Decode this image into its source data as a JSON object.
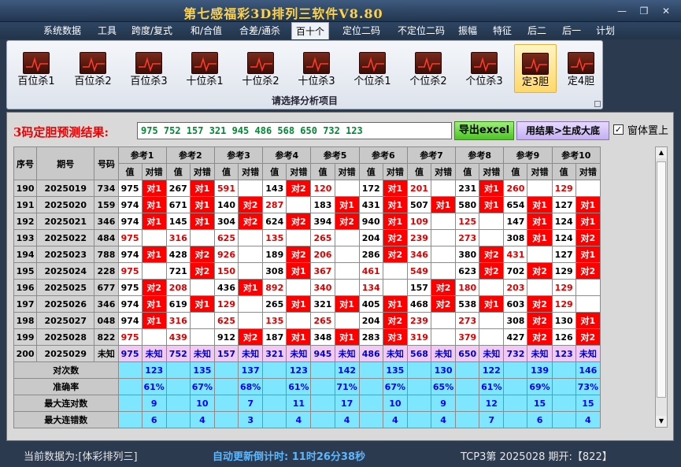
{
  "window": {
    "title": "第七感福彩3D排列三软件V8.80"
  },
  "menu": [
    "系统数据",
    "工具",
    "跨度/复式",
    "和/合值",
    "合差/通杀",
    "百十个",
    "定位二码",
    "不定位二码",
    "振幅",
    "特征",
    "后二",
    "后一",
    "计划"
  ],
  "active_menu": "百十个",
  "ribbon": {
    "buttons": [
      "百位杀1",
      "百位杀2",
      "百位杀3",
      "十位杀1",
      "十位杀2",
      "十位杀3",
      "个位杀1",
      "个位杀2",
      "个位杀3",
      "定3胆",
      "定4胆"
    ],
    "selected": "定3胆",
    "caption": "请选择分析项目"
  },
  "prediction": {
    "label": "3码定胆预测结果:",
    "value": "975 752 157 321 945 486 568 650 732 123"
  },
  "buttons": {
    "excel": "导出excel",
    "generate": "用结果>生成大底"
  },
  "checkbox": {
    "label": "窗体置上",
    "checked": "✓"
  },
  "table": {
    "headers": {
      "seq": "序号",
      "period": "期号",
      "number": "号码",
      "value": "值",
      "result": "对错"
    },
    "refs": [
      "参考1",
      "参考2",
      "参考3",
      "参考4",
      "参考5",
      "参考6",
      "参考7",
      "参考8",
      "参考9",
      "参考10"
    ],
    "rows": [
      {
        "seq": "190",
        "period": "2025019",
        "number": "734",
        "cells": [
          [
            "975",
            "对1"
          ],
          [
            "267",
            "对1"
          ],
          [
            "591",
            ""
          ],
          [
            "143",
            "对2"
          ],
          [
            "120",
            ""
          ],
          [
            "172",
            "对1"
          ],
          [
            "201",
            ""
          ],
          [
            "231",
            "对1"
          ],
          [
            "260",
            ""
          ],
          [
            "129",
            ""
          ]
        ]
      },
      {
        "seq": "191",
        "period": "2025020",
        "number": "159",
        "cells": [
          [
            "974",
            "对1"
          ],
          [
            "671",
            "对1"
          ],
          [
            "140",
            "对2"
          ],
          [
            "287",
            ""
          ],
          [
            "183",
            "对1"
          ],
          [
            "431",
            "对1"
          ],
          [
            "507",
            "对1"
          ],
          [
            "580",
            "对1"
          ],
          [
            "654",
            "对1"
          ],
          [
            "127",
            "对1"
          ]
        ]
      },
      {
        "seq": "192",
        "period": "2025021",
        "number": "346",
        "cells": [
          [
            "974",
            "对1"
          ],
          [
            "145",
            "对1"
          ],
          [
            "304",
            "对2"
          ],
          [
            "624",
            "对2"
          ],
          [
            "394",
            "对2"
          ],
          [
            "940",
            "对1"
          ],
          [
            "109",
            ""
          ],
          [
            "125",
            ""
          ],
          [
            "147",
            "对1"
          ],
          [
            "124",
            "对1"
          ]
        ]
      },
      {
        "seq": "193",
        "period": "2025022",
        "number": "484",
        "cells": [
          [
            "975",
            ""
          ],
          [
            "316",
            ""
          ],
          [
            "625",
            ""
          ],
          [
            "135",
            ""
          ],
          [
            "265",
            ""
          ],
          [
            "204",
            "对2"
          ],
          [
            "239",
            ""
          ],
          [
            "273",
            ""
          ],
          [
            "308",
            "对1"
          ],
          [
            "124",
            "对2"
          ]
        ]
      },
      {
        "seq": "194",
        "period": "2025023",
        "number": "788",
        "cells": [
          [
            "974",
            "对1"
          ],
          [
            "428",
            "对2"
          ],
          [
            "926",
            ""
          ],
          [
            "189",
            "对2"
          ],
          [
            "206",
            ""
          ],
          [
            "286",
            "对2"
          ],
          [
            "346",
            ""
          ],
          [
            "380",
            "对2"
          ],
          [
            "431",
            ""
          ],
          [
            "127",
            "对1"
          ]
        ]
      },
      {
        "seq": "195",
        "period": "2025024",
        "number": "228",
        "cells": [
          [
            "975",
            ""
          ],
          [
            "721",
            "对2"
          ],
          [
            "150",
            ""
          ],
          [
            "308",
            "对1"
          ],
          [
            "367",
            ""
          ],
          [
            "461",
            ""
          ],
          [
            "549",
            ""
          ],
          [
            "623",
            "对2"
          ],
          [
            "702",
            "对2"
          ],
          [
            "129",
            "对2"
          ]
        ]
      },
      {
        "seq": "196",
        "period": "2025025",
        "number": "677",
        "cells": [
          [
            "975",
            "对2"
          ],
          [
            "208",
            ""
          ],
          [
            "436",
            "对1"
          ],
          [
            "892",
            ""
          ],
          [
            "340",
            ""
          ],
          [
            "134",
            ""
          ],
          [
            "157",
            "对2"
          ],
          [
            "180",
            ""
          ],
          [
            "203",
            ""
          ],
          [
            "129",
            ""
          ]
        ]
      },
      {
        "seq": "197",
        "period": "2025026",
        "number": "346",
        "cells": [
          [
            "974",
            "对1"
          ],
          [
            "619",
            "对1"
          ],
          [
            "129",
            ""
          ],
          [
            "265",
            "对1"
          ],
          [
            "321",
            "对1"
          ],
          [
            "405",
            "对1"
          ],
          [
            "468",
            "对2"
          ],
          [
            "538",
            "对1"
          ],
          [
            "603",
            "对2"
          ],
          [
            "129",
            ""
          ]
        ]
      },
      {
        "seq": "198",
        "period": "2025027",
        "number": "048",
        "cells": [
          [
            "974",
            "对1"
          ],
          [
            "316",
            ""
          ],
          [
            "625",
            ""
          ],
          [
            "135",
            ""
          ],
          [
            "265",
            ""
          ],
          [
            "204",
            "对2"
          ],
          [
            "239",
            ""
          ],
          [
            "273",
            ""
          ],
          [
            "308",
            "对2"
          ],
          [
            "130",
            "对1"
          ]
        ]
      },
      {
        "seq": "199",
        "period": "2025028",
        "number": "822",
        "cells": [
          [
            "975",
            ""
          ],
          [
            "439",
            ""
          ],
          [
            "912",
            "对2"
          ],
          [
            "187",
            "对1"
          ],
          [
            "348",
            "对1"
          ],
          [
            "283",
            "对3"
          ],
          [
            "319",
            ""
          ],
          [
            "379",
            ""
          ],
          [
            "427",
            "对2"
          ],
          [
            "126",
            "对2"
          ]
        ]
      },
      {
        "seq": "200",
        "period": "2025029",
        "number": "未知",
        "cells": [
          [
            "975",
            "未知"
          ],
          [
            "752",
            "未知"
          ],
          [
            "157",
            "未知"
          ],
          [
            "321",
            "未知"
          ],
          [
            "945",
            "未知"
          ],
          [
            "486",
            "未知"
          ],
          [
            "568",
            "未知"
          ],
          [
            "650",
            "未知"
          ],
          [
            "732",
            "未知"
          ],
          [
            "123",
            "未知"
          ]
        ]
      }
    ],
    "stats": [
      {
        "label": "对次数",
        "values": [
          "123",
          "135",
          "137",
          "123",
          "142",
          "135",
          "130",
          "122",
          "139",
          "146"
        ]
      },
      {
        "label": "准确率",
        "values": [
          "61%",
          "67%",
          "68%",
          "61%",
          "71%",
          "67%",
          "65%",
          "61%",
          "69%",
          "73%"
        ]
      },
      {
        "label": "最大连对数",
        "values": [
          "9",
          "10",
          "7",
          "11",
          "17",
          "10",
          "9",
          "12",
          "15",
          "15"
        ]
      },
      {
        "label": "最大连错数",
        "values": [
          "6",
          "4",
          "3",
          "4",
          "4",
          "4",
          "4",
          "7",
          "6",
          "4"
        ]
      }
    ]
  },
  "status": {
    "current": "当前数据为:[体彩排列三]",
    "countdown": "自动更新倒计时: 11时26分38秒",
    "draw": "TCP3第 2025028 期开:【822】"
  },
  "colors": {
    "hit": "#ff0000",
    "miss_text": "#e00000",
    "stat_bg": "#7fe6ff",
    "unknown_bg": "#f2c9f2",
    "title": "#ffd24a"
  }
}
